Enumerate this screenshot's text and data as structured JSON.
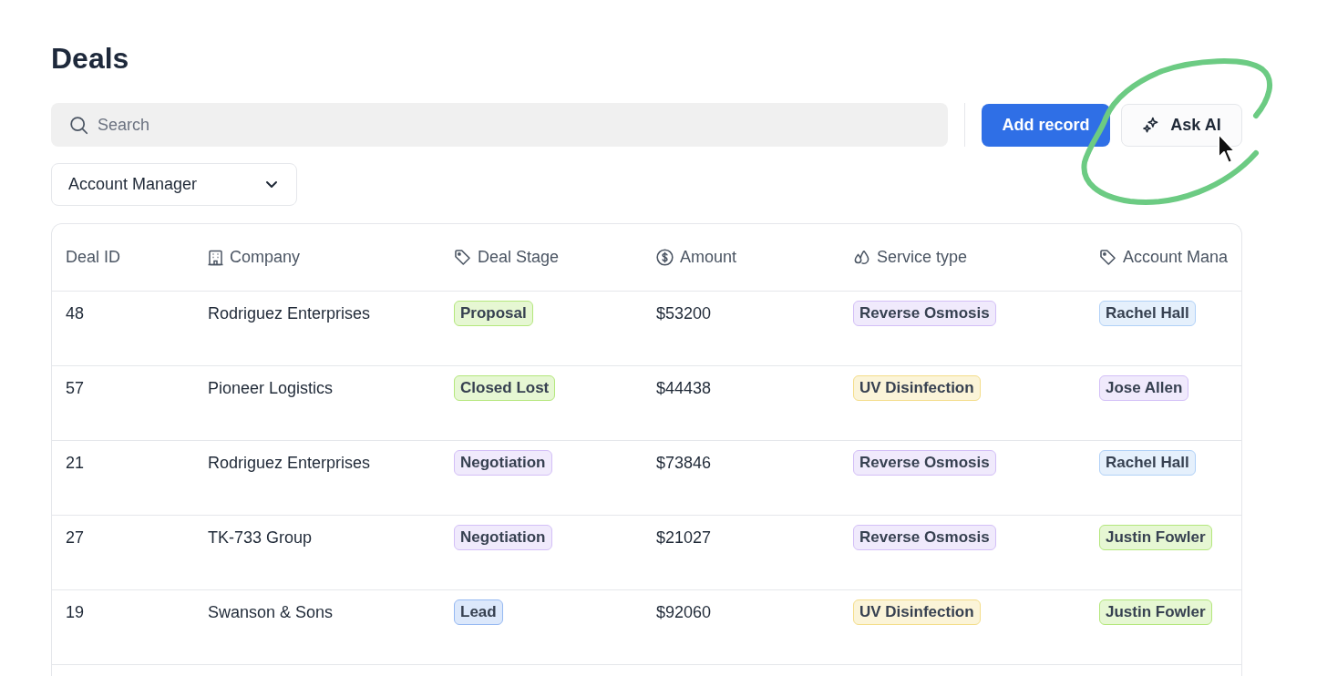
{
  "page": {
    "title": "Deals"
  },
  "toolbar": {
    "search": {
      "placeholder": "Search"
    },
    "buttons": [
      {
        "label": "Add record",
        "kind": "primary"
      },
      {
        "label": "Ask AI",
        "kind": "ai"
      }
    ]
  },
  "filters": [
    {
      "label": "Account Manager"
    }
  ],
  "table": {
    "columns": [
      {
        "label": "Deal ID"
      },
      {
        "label": "Company"
      },
      {
        "label": "Deal Stage"
      },
      {
        "label": "Amount"
      },
      {
        "label": "Service type"
      },
      {
        "label": "Account Mana"
      }
    ],
    "rows": [
      {
        "cells": [
          {
            "kind": "text",
            "text": "48"
          },
          {
            "kind": "text",
            "text": "Rodriguez Enterprises"
          },
          {
            "kind": "tag",
            "text": "Proposal",
            "color": "#b4e77c"
          },
          {
            "kind": "text",
            "text": "$53200"
          },
          {
            "kind": "tag",
            "text": "Reverse Osmosis",
            "color": "#d3bff7"
          },
          {
            "kind": "tag",
            "text": "Rachel Hall",
            "color": "#b1d1f7"
          }
        ]
      },
      {
        "cells": [
          {
            "kind": "text",
            "text": "57"
          },
          {
            "kind": "text",
            "text": "Pioneer Logistics"
          },
          {
            "kind": "tag",
            "text": "Closed Lost",
            "color": "#b4e77c"
          },
          {
            "kind": "text",
            "text": "$44438"
          },
          {
            "kind": "tag",
            "text": "UV Disinfection",
            "color": "#f4dd8a"
          },
          {
            "kind": "tag",
            "text": "Jose Allen",
            "color": "#d3bff7"
          }
        ]
      },
      {
        "cells": [
          {
            "kind": "text",
            "text": "21"
          },
          {
            "kind": "text",
            "text": "Rodriguez Enterprises"
          },
          {
            "kind": "tag",
            "text": "Negotiation",
            "color": "#d3bff7"
          },
          {
            "kind": "text",
            "text": "$73846"
          },
          {
            "kind": "tag",
            "text": "Reverse Osmosis",
            "color": "#d3bff7"
          },
          {
            "kind": "tag",
            "text": "Rachel Hall",
            "color": "#b1d1f7"
          }
        ]
      },
      {
        "cells": [
          {
            "kind": "text",
            "text": "27"
          },
          {
            "kind": "text",
            "text": "TK-733 Group"
          },
          {
            "kind": "tag",
            "text": "Negotiation",
            "color": "#d3bff7"
          },
          {
            "kind": "text",
            "text": "$21027"
          },
          {
            "kind": "tag",
            "text": "Reverse Osmosis",
            "color": "#d3bff7"
          },
          {
            "kind": "tag",
            "text": "Justin Fowler",
            "color": "#b4e77c"
          }
        ]
      },
      {
        "cells": [
          {
            "kind": "text",
            "text": "19"
          },
          {
            "kind": "text",
            "text": "Swanson & Sons"
          },
          {
            "kind": "tag",
            "text": "Lead",
            "color": "#96b9f2"
          },
          {
            "kind": "text",
            "text": "$92060"
          },
          {
            "kind": "tag",
            "text": "UV Disinfection",
            "color": "#f4dd8a"
          },
          {
            "kind": "tag",
            "text": "Justin Fowler",
            "color": "#b4e77c"
          }
        ]
      }
    ]
  }
}
